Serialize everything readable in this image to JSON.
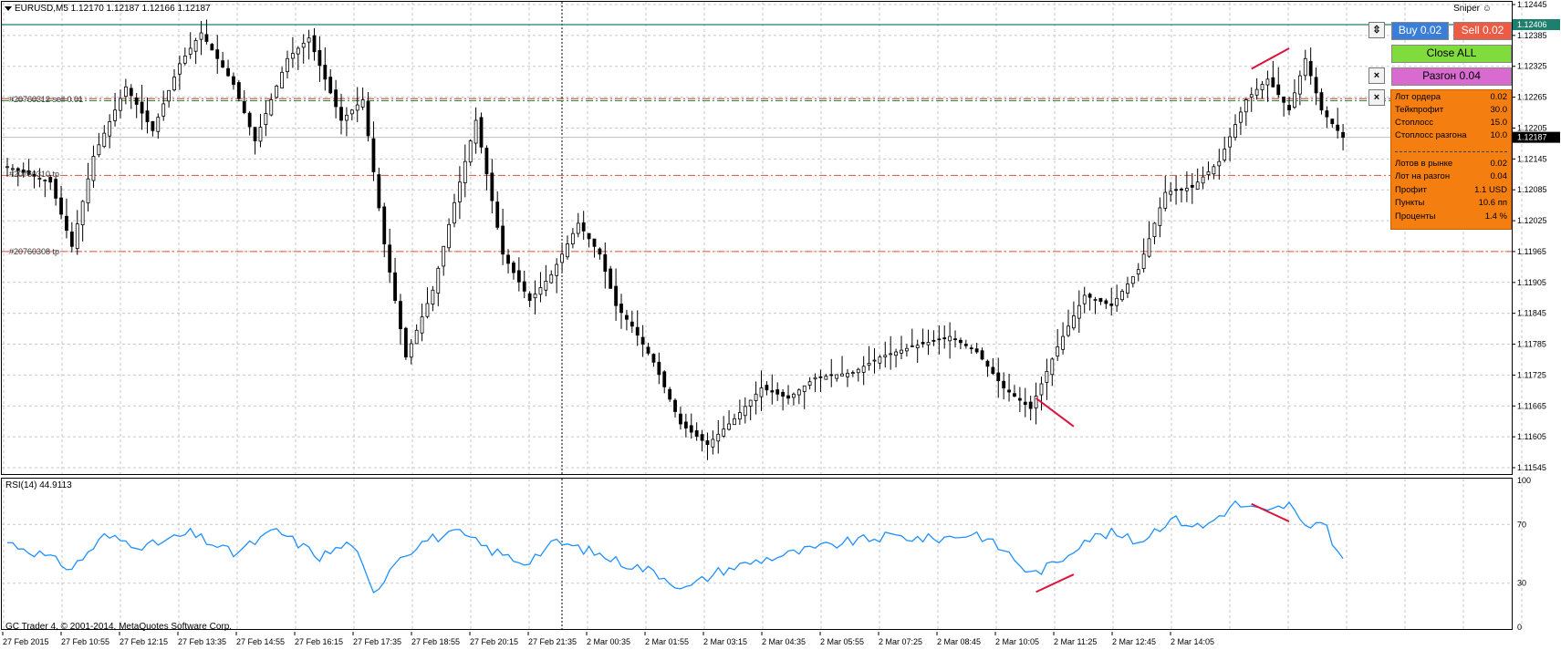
{
  "window": {
    "symbol_header": "EURUSD,M5  1.12170 1.12187 1.12166 1.12187",
    "expert": "Sniper",
    "expert_icon": "smiley-icon",
    "copyright": "GC Trader 4, © 2001-2014, MetaQuotes Software Corp."
  },
  "price_axis": {
    "labels": [
      "1.12445",
      "1.12385",
      "1.12325",
      "1.12265",
      "1.12205",
      "1.12145",
      "1.12085",
      "1.12025",
      "1.11965",
      "1.11905",
      "1.11845",
      "1.11785",
      "1.11725",
      "1.11665",
      "1.11605",
      "1.11545"
    ],
    "ask_label": "1.12406",
    "bid_label": "1.12187"
  },
  "time_axis": {
    "labels": [
      "27 Feb 2015",
      "27 Feb 10:55",
      "27 Feb 12:15",
      "27 Feb 13:35",
      "27 Feb 14:55",
      "27 Feb 16:15",
      "27 Feb 17:35",
      "27 Feb 18:55",
      "27 Feb 20:15",
      "27 Feb 21:35",
      "2 Mar 00:35",
      "2 Mar 01:55",
      "2 Mar 03:15",
      "2 Mar 04:35",
      "2 Mar 05:55",
      "2 Mar 07:25",
      "2 Mar 08:45",
      "2 Mar 10:05",
      "2 Mar 11:25",
      "2 Mar 12:45",
      "2 Mar 14:05"
    ]
  },
  "order_lines": [
    {
      "label": "#20760312 sell 0.01",
      "price": 1.12258,
      "color": "#2e8b2e"
    },
    {
      "label": "#20760312 sl",
      "price": 1.12262,
      "color": "#cc3333"
    },
    {
      "label": "#20760310 tp",
      "price": 1.12113,
      "color": "#e05030"
    },
    {
      "label": "#20760308 tp",
      "price": 1.11965,
      "color": "#e05030"
    }
  ],
  "buttons": {
    "buy": "Buy 0.02",
    "sell": "Sell 0.02",
    "close_all": "Close ALL",
    "razgon": "Разгон 0.04",
    "pin_icon": "pin-icon",
    "close_icon": "close-icon"
  },
  "colors": {
    "buy": "#3a7ed8",
    "sell": "#ee5b45",
    "close_all": "#7fdc3c",
    "razgon": "#d86ad0",
    "panel": "#f47f10",
    "candles": "#000000",
    "rsi": "#1e90ff",
    "divergence": "#dc143c",
    "ask_line": "#1e7f6e"
  },
  "panel": {
    "rows": [
      {
        "label": "Лот ордера",
        "value": "0.02"
      },
      {
        "label": "Тейкпрофит",
        "value": "30.0"
      },
      {
        "label": "Стоплосс",
        "value": "15.0"
      },
      {
        "label": "Стоплосс разгона",
        "value": "10.0"
      },
      {
        "label": "Лотов в рынке",
        "value": "0.02"
      },
      {
        "label": "Лот на разгон",
        "value": "0.04"
      },
      {
        "label": "Профит",
        "value": "1.1 USD"
      },
      {
        "label": "Пункты",
        "value": "10.6 пп"
      },
      {
        "label": "Проценты",
        "value": "1.4 %"
      }
    ]
  },
  "rsi": {
    "header": "RSI(14) 44.9113",
    "period": 14,
    "current": 44.9113,
    "axis_labels": [
      "100",
      "70",
      "30",
      "0"
    ],
    "levels": [
      70,
      30
    ]
  },
  "chart_data": {
    "type": "candlestick",
    "symbol": "EURUSD",
    "timeframe": "M5",
    "last": {
      "open": 1.1217,
      "high": 1.12187,
      "low": 1.12166,
      "close": 1.12187
    },
    "ylim": [
      1.11545,
      1.12445
    ],
    "anchors": [
      {
        "i": 0,
        "p": 1.1213
      },
      {
        "i": 8,
        "p": 1.121
      },
      {
        "i": 12,
        "p": 1.11975
      },
      {
        "i": 16,
        "p": 1.1215
      },
      {
        "i": 22,
        "p": 1.12285
      },
      {
        "i": 27,
        "p": 1.122
      },
      {
        "i": 32,
        "p": 1.1233
      },
      {
        "i": 36,
        "p": 1.1239
      },
      {
        "i": 42,
        "p": 1.1229
      },
      {
        "i": 46,
        "p": 1.1218
      },
      {
        "i": 52,
        "p": 1.1234
      },
      {
        "i": 56,
        "p": 1.1238
      },
      {
        "i": 62,
        "p": 1.1222
      },
      {
        "i": 66,
        "p": 1.1226
      },
      {
        "i": 70,
        "p": 1.1198
      },
      {
        "i": 74,
        "p": 1.1176
      },
      {
        "i": 79,
        "p": 1.1189
      },
      {
        "i": 83,
        "p": 1.1206
      },
      {
        "i": 87,
        "p": 1.1222
      },
      {
        "i": 92,
        "p": 1.1196
      },
      {
        "i": 97,
        "p": 1.1187
      },
      {
        "i": 101,
        "p": 1.1192
      },
      {
        "i": 106,
        "p": 1.1202
      },
      {
        "i": 110,
        "p": 1.1196
      },
      {
        "i": 113,
        "p": 1.1186
      },
      {
        "i": 116,
        "p": 1.1182
      },
      {
        "i": 120,
        "p": 1.1175
      },
      {
        "i": 125,
        "p": 1.1163
      },
      {
        "i": 130,
        "p": 1.1159
      },
      {
        "i": 135,
        "p": 1.1164
      },
      {
        "i": 140,
        "p": 1.117
      },
      {
        "i": 145,
        "p": 1.1168
      },
      {
        "i": 150,
        "p": 1.1172
      },
      {
        "i": 157,
        "p": 1.1173
      },
      {
        "i": 162,
        "p": 1.1176
      },
      {
        "i": 168,
        "p": 1.1178
      },
      {
        "i": 175,
        "p": 1.118
      },
      {
        "i": 180,
        "p": 1.1177
      },
      {
        "i": 185,
        "p": 1.117
      },
      {
        "i": 190,
        "p": 1.1166
      },
      {
        "i": 195,
        "p": 1.1178
      },
      {
        "i": 200,
        "p": 1.1188
      },
      {
        "i": 205,
        "p": 1.1186
      },
      {
        "i": 210,
        "p": 1.1193
      },
      {
        "i": 215,
        "p": 1.1208
      },
      {
        "i": 220,
        "p": 1.1209
      },
      {
        "i": 225,
        "p": 1.1214
      },
      {
        "i": 230,
        "p": 1.1226
      },
      {
        "i": 234,
        "p": 1.123
      },
      {
        "i": 238,
        "p": 1.1224
      },
      {
        "i": 241,
        "p": 1.1234
      },
      {
        "i": 244,
        "p": 1.1224
      },
      {
        "i": 248,
        "p": 1.12187
      }
    ],
    "rsi_anchors": [
      {
        "i": 0,
        "v": 58
      },
      {
        "i": 6,
        "v": 50
      },
      {
        "i": 12,
        "v": 40
      },
      {
        "i": 18,
        "v": 62
      },
      {
        "i": 26,
        "v": 55
      },
      {
        "i": 34,
        "v": 64
      },
      {
        "i": 42,
        "v": 50
      },
      {
        "i": 50,
        "v": 66
      },
      {
        "i": 58,
        "v": 48
      },
      {
        "i": 64,
        "v": 58
      },
      {
        "i": 68,
        "v": 22
      },
      {
        "i": 72,
        "v": 46
      },
      {
        "i": 78,
        "v": 60
      },
      {
        "i": 84,
        "v": 64
      },
      {
        "i": 90,
        "v": 52
      },
      {
        "i": 96,
        "v": 44
      },
      {
        "i": 102,
        "v": 58
      },
      {
        "i": 108,
        "v": 52
      },
      {
        "i": 114,
        "v": 44
      },
      {
        "i": 120,
        "v": 38
      },
      {
        "i": 126,
        "v": 26
      },
      {
        "i": 132,
        "v": 38
      },
      {
        "i": 140,
        "v": 46
      },
      {
        "i": 148,
        "v": 52
      },
      {
        "i": 156,
        "v": 58
      },
      {
        "i": 164,
        "v": 62
      },
      {
        "i": 172,
        "v": 60
      },
      {
        "i": 180,
        "v": 64
      },
      {
        "i": 186,
        "v": 50
      },
      {
        "i": 190,
        "v": 36
      },
      {
        "i": 195,
        "v": 44
      },
      {
        "i": 200,
        "v": 60
      },
      {
        "i": 205,
        "v": 64
      },
      {
        "i": 210,
        "v": 58
      },
      {
        "i": 216,
        "v": 74
      },
      {
        "i": 222,
        "v": 68
      },
      {
        "i": 228,
        "v": 84
      },
      {
        "i": 234,
        "v": 78
      },
      {
        "i": 238,
        "v": 84
      },
      {
        "i": 241,
        "v": 66
      },
      {
        "i": 244,
        "v": 74
      },
      {
        "i": 248,
        "v": 45
      }
    ],
    "divergences": [
      {
        "pane": "price",
        "from": {
          "i": 191,
          "p": 1.1168
        },
        "to": {
          "i": 198,
          "p": 1.11625
        }
      },
      {
        "pane": "price",
        "from": {
          "i": 231,
          "p": 1.1232
        },
        "to": {
          "i": 238,
          "p": 1.1236
        }
      },
      {
        "pane": "rsi",
        "from": {
          "i": 191,
          "v": 24
        },
        "to": {
          "i": 198,
          "v": 36
        }
      },
      {
        "pane": "rsi",
        "from": {
          "i": 231,
          "v": 84
        },
        "to": {
          "i": 238,
          "v": 72
        }
      }
    ]
  }
}
